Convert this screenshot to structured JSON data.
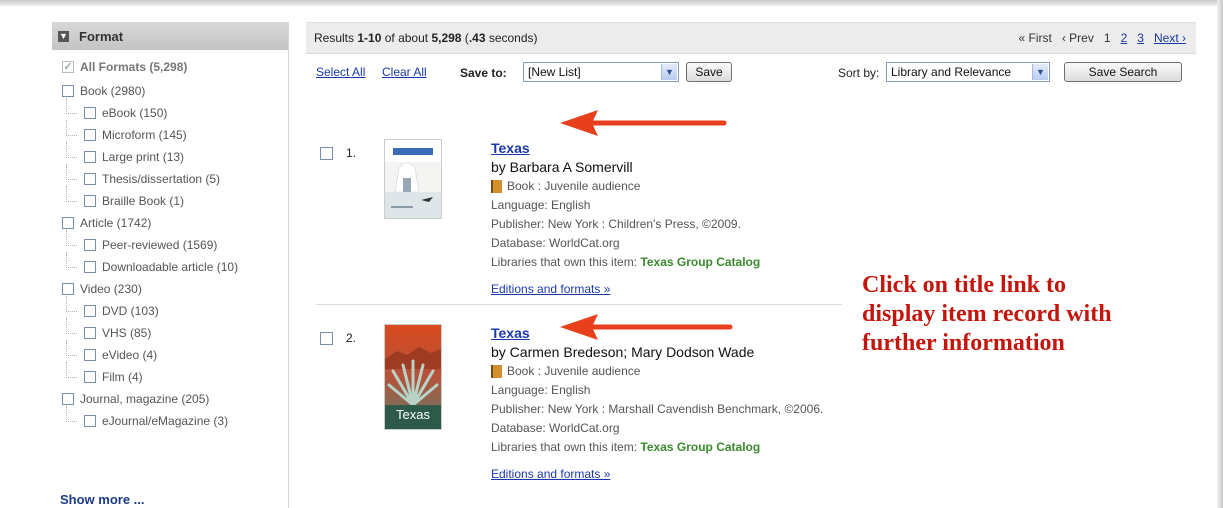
{
  "sidebar": {
    "header": "Format",
    "items": [
      {
        "label": "All Formats (5,298)",
        "checked": true,
        "level": 0
      },
      {
        "label": "Book (2980)",
        "level": 0
      },
      {
        "label": "eBook (150)",
        "level": 1
      },
      {
        "label": "Microform (145)",
        "level": 1
      },
      {
        "label": "Large print (13)",
        "level": 1
      },
      {
        "label": "Thesis/dissertation (5)",
        "level": 1
      },
      {
        "label": "Braille Book (1)",
        "level": 1
      },
      {
        "label": "Article (1742)",
        "level": 0
      },
      {
        "label": "Peer-reviewed (1569)",
        "level": 1
      },
      {
        "label": "Downloadable article (10)",
        "level": 1
      },
      {
        "label": "Video (230)",
        "level": 0
      },
      {
        "label": "DVD (103)",
        "level": 1
      },
      {
        "label": "VHS (85)",
        "level": 1
      },
      {
        "label": "eVideo (4)",
        "level": 1
      },
      {
        "label": "Film (4)",
        "level": 1
      },
      {
        "label": "Journal, magazine (205)",
        "level": 0
      },
      {
        "label": "eJournal/eMagazine (3)",
        "level": 1
      }
    ],
    "show_more": "Show more ..."
  },
  "results_bar": {
    "prefix": "Results ",
    "range": "1-10",
    "middle": " of about ",
    "total": "5,298",
    "time_open": " (",
    "time": ".43",
    "time_close": " seconds)"
  },
  "pager": {
    "first": "« First",
    "prev": "‹ Prev",
    "current": "1",
    "page2": "2",
    "page3": "3",
    "next": "Next ›"
  },
  "toolbar": {
    "select_all": "Select All",
    "clear_all": "Clear All",
    "save_to_label": "Save to:",
    "save_to_value": "[New List]",
    "save_button": "Save",
    "sort_label": "Sort by:",
    "sort_value": "Library and Relevance",
    "save_search_button": "Save Search"
  },
  "records": [
    {
      "number": "1.",
      "title": "Texas",
      "author": "by Barbara A Somervill",
      "format": "Book : Juvenile audience",
      "language": "Language: English",
      "publisher": "Publisher: New York : Children's Press, ©2009.",
      "database": "Database: WorldCat.org",
      "libraries_label": "Libraries that own this item: ",
      "libraries_value": "Texas Group Catalog",
      "editions": "Editions and formats »"
    },
    {
      "number": "2.",
      "title": "Texas",
      "author": "by Carmen Bredeson; Mary Dodson Wade",
      "format": "Book : Juvenile audience",
      "language": "Language: English",
      "publisher": "Publisher: New York : Marshall Cavendish Benchmark, ©2006.",
      "database": "Database: WorldCat.org",
      "libraries_label": "Libraries that own this item: ",
      "libraries_value": "Texas Group Catalog",
      "editions": "Editions and formats »",
      "cover_text": "Texas"
    }
  ],
  "callout": {
    "line1": "Click on title link to",
    "line2": "display item record with",
    "line3": "further information"
  },
  "colors": {
    "link": "#1a3aa8",
    "library_green": "#3a8a2e",
    "annotation_red": "#c4160d",
    "arrow_red": "#e8401c"
  }
}
